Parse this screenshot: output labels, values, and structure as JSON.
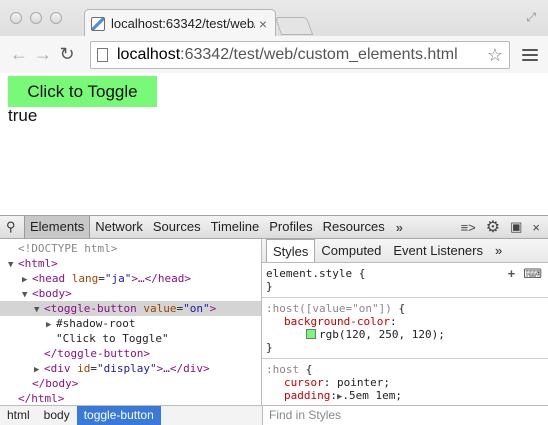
{
  "browser": {
    "tab_title": "localhost:63342/test/web/",
    "tab_close": "×",
    "url_host": "localhost",
    "url_rest": ":63342/test/web/custom_elements.html",
    "back_glyph": "←",
    "forward_glyph": "→",
    "reload_glyph": "↻",
    "star_glyph": "☆",
    "fullscreen_glyph": "⤢"
  },
  "page": {
    "button_label": "Click to Toggle",
    "display_text": "true",
    "button_color": "rgb(120, 250, 120)"
  },
  "devtools": {
    "tabs": [
      "Elements",
      "Network",
      "Sources",
      "Timeline",
      "Profiles",
      "Resources"
    ],
    "more": "»",
    "dom": {
      "doctype": "<!DOCTYPE html>",
      "html_open": "<html>",
      "head_tag": "<head",
      "head_attr_name": "lang",
      "head_attr_val": "\"ja\"",
      "head_rest": ">…</head>",
      "body_open": "<body>",
      "toggle_tag": "<toggle-button",
      "toggle_attr_name": "value",
      "toggle_attr_val": "\"on\"",
      "toggle_close_bracket": ">",
      "shadow_root": "#shadow-root",
      "text_node": "\"Click to Toggle\"",
      "toggle_close": "</toggle-button>",
      "div_tag": "<div",
      "div_attr_name": "id",
      "div_attr_val": "\"display\"",
      "div_rest": ">…</div>",
      "body_close": "</body>",
      "html_close": "</html>"
    },
    "styles_tabs": [
      "Styles",
      "Computed",
      "Event Listeners"
    ],
    "styles_more": "»",
    "rules": {
      "element_style": "element.style {",
      "close": "}",
      "host_value_selector_dim": ":host([value=\"on\"])",
      "host_value_brace": " {",
      "bg_name": "background-color",
      "bg_value": "rgb(120, 250, 120);",
      "host_selector": ":host",
      "cursor_name": "cursor",
      "cursor_value": "pointer;",
      "padding_name": "padding",
      "padding_value": ".5em 1em;"
    },
    "breadcrumbs": [
      "html",
      "body",
      "toggle-button"
    ],
    "find_placeholder": "Find in Styles"
  },
  "colors": {
    "toggle_green": "#78fa78",
    "breadcrumb_selected": "#3879d9"
  }
}
